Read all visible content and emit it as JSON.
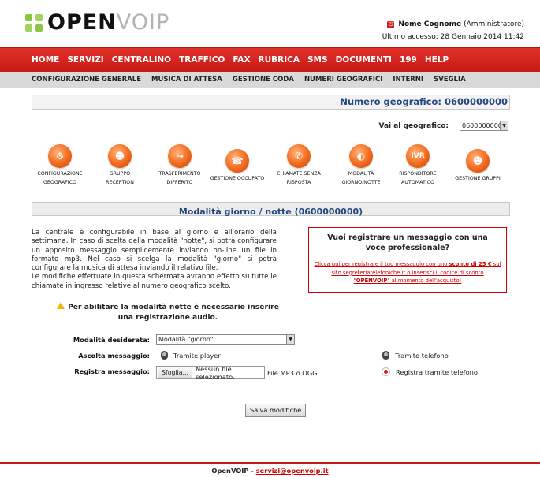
{
  "header": {
    "logo_open": "OPEN",
    "logo_voip": "VOIP",
    "user_name": "Nome Cognome",
    "user_role": "(Amministratore)",
    "last_access": "Ultimo accesso: 28 Gennaio 2014 11:42"
  },
  "main_nav": [
    "HOME",
    "SERVIZI",
    "CENTRALINO",
    "TRAFFICO",
    "FAX",
    "RUBRICA",
    "SMS",
    "DOCUMENTI",
    "199",
    "HELP"
  ],
  "sub_nav": [
    "CONFIGURAZIONE GENERALE",
    "MUSICA DI ATTESA",
    "GESTIONE CODA",
    "NUMERI GEOGRAFICI",
    "INTERNI",
    "SVEGLIA"
  ],
  "number_bar": "Numero geografico: 0600000000",
  "goto": {
    "label": "Vai al geografico:",
    "value": "0600000000"
  },
  "tools": [
    {
      "icon": "configuration-icon",
      "glyph": "⚙",
      "line1": "CONFIGURAZIONE",
      "line2": "GEOGRAFICO"
    },
    {
      "icon": "group-reception-icon",
      "glyph": "☻",
      "line1": "GRUPPO",
      "line2": "RECEPTION"
    },
    {
      "icon": "deferred-transfer-icon",
      "glyph": "↪",
      "line1": "TRASFERIMENTO",
      "line2": "DIFFERITO"
    },
    {
      "icon": "busy-phone-icon",
      "glyph": "☎",
      "line1": "GESTIONE OCCUPATO",
      "line2": ""
    },
    {
      "icon": "unanswered-calls-icon",
      "glyph": "✆",
      "line1": "CHIAMATE SENZA",
      "line2": "RISPOSTA"
    },
    {
      "icon": "day-night-mode-icon",
      "glyph": "◐",
      "line1": "MODALITÀ",
      "line2": "GIORNO/NOTTE"
    },
    {
      "icon": "ivr-icon",
      "glyph": "IVR",
      "line1": "RISPONDITORE",
      "line2": "AUTOMATICO"
    },
    {
      "icon": "groups-icon",
      "glyph": "☻",
      "line1": "GESTIONE GRUPPI",
      "line2": ""
    }
  ],
  "section_title": "Modalità giorno / notte (0600000000)",
  "description": "La centrale è configurabile in base al giorno e all'orario della settimana. In caso di scelta della modalità \"notte\", si potrà configurare un apposito messaggio semplicemente inviando on-line un file in formato mp3. Nel caso si scelga la modalità \"giorno\" si potrà configurare la musica di attesa inviando il relativo file.",
  "description2": "Le modifiche effettuate in questa schermata avranno effetto su tutte le chiamate in ingresso relative al numero geografico scelto.",
  "promo": {
    "title": "Vuoi registrare un messaggio con una voce professionale?",
    "link_part1": "Clicca qui per registrare il tuo messaggio con uno ",
    "link_bold1": "sconto di 25 €",
    "link_part2": " sul sito segreteriatelefoniche.it o inserisci il codice di sconto \"",
    "link_bold2": "OPENVOIP",
    "link_part3": "\" al momento dell'acquisto!"
  },
  "warning": "Per abilitare la modalità notte è necessario inserire una registrazione audio.",
  "form": {
    "mode_label": "Modalità desiderata:",
    "mode_value": "Modalità \"giorno\"",
    "listen_label": "Ascolta messaggio:",
    "listen_player": "Tramite player",
    "listen_phone": "Tramite telefono",
    "record_label": "Registra messaggio:",
    "browse_button": "Sfoglia...",
    "no_file": "Nessun file selezionato.",
    "file_format": "File MP3 o OGG",
    "record_phone": "Registra tramite telefono",
    "save_button": "Salva modifiche"
  },
  "footer": {
    "brand": "OpenVOIP - ",
    "email": "servizi@openvoip.it"
  },
  "colors": {
    "accent_red": "#c81a14",
    "title_blue": "#24477f",
    "icon_orange": "#f2691d",
    "logo_green": "#8cc63f"
  }
}
